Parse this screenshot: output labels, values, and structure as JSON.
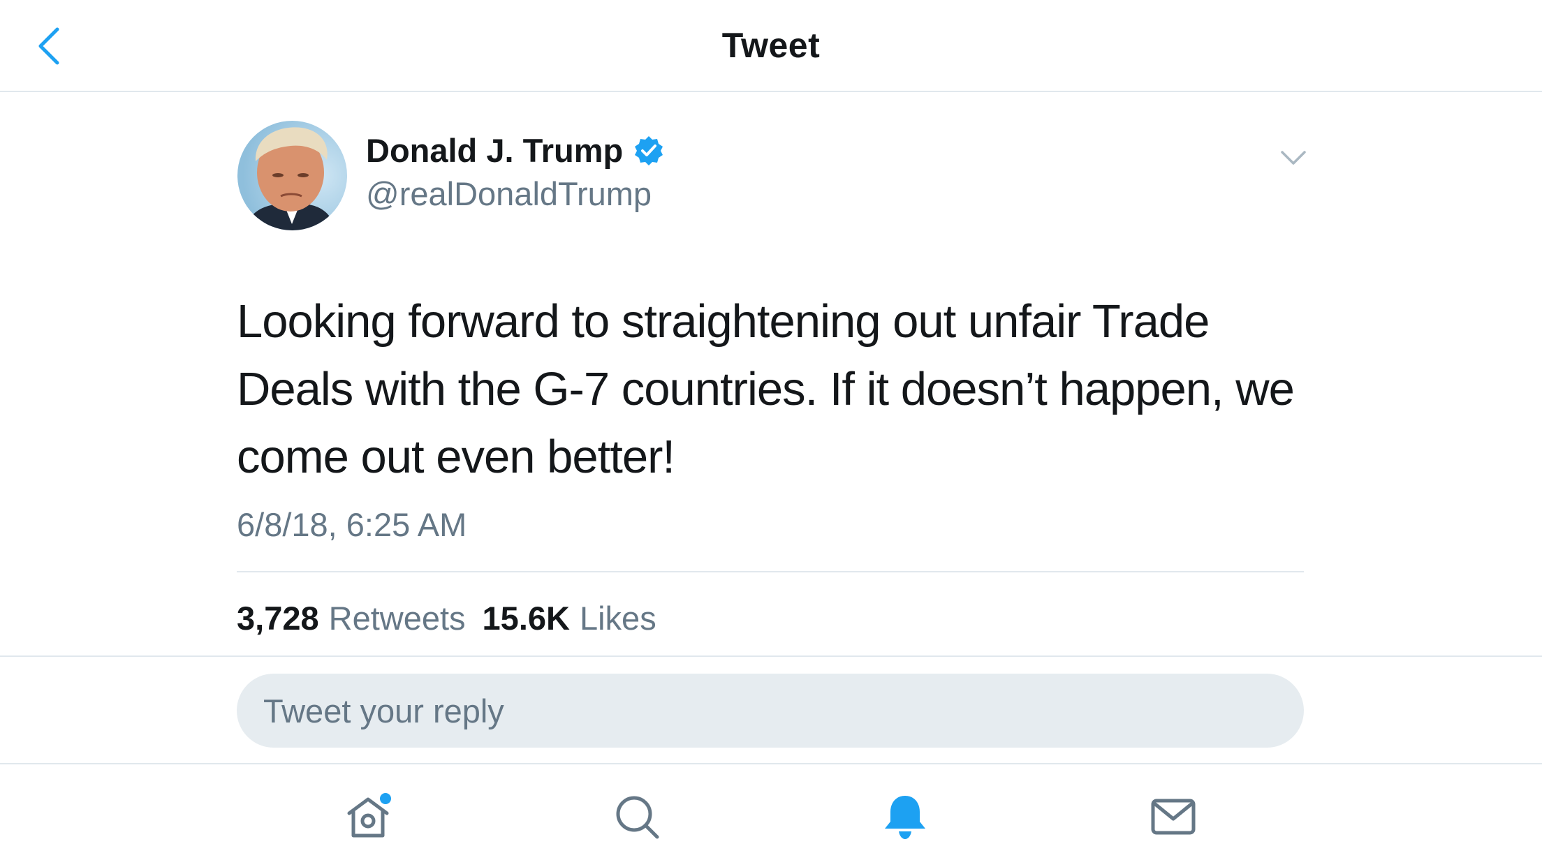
{
  "header": {
    "title": "Tweet",
    "back_icon": "chevron-left-icon"
  },
  "tweet": {
    "author_name": "Donald J. Trump",
    "verified_icon": "verified-badge-icon",
    "handle": "@realDonaldTrump",
    "menu_icon": "chevron-down-icon",
    "text": "Looking forward to straightening out unfair Trade Deals with the G-7 countries. If it doesn’t happen, we come out even better!",
    "timestamp": "6/8/18, 6:25 AM",
    "stats": {
      "retweets_count": "3,728",
      "retweets_label": "Retweets",
      "likes_count": "15.6K",
      "likes_label": "Likes"
    }
  },
  "reply": {
    "placeholder": "Tweet your reply"
  },
  "tabbar": {
    "items": [
      {
        "icon": "home-icon",
        "active": false,
        "badge_dot": true
      },
      {
        "icon": "search-icon",
        "active": false
      },
      {
        "icon": "notifications-bell-icon",
        "active": true
      },
      {
        "icon": "messages-envelope-icon",
        "active": false
      }
    ]
  },
  "colors": {
    "accent": "#1da1f2",
    "text": "#14171a",
    "secondary": "#657786",
    "divider": "#e1e8ed",
    "reply_bg": "#e6ecf0"
  }
}
